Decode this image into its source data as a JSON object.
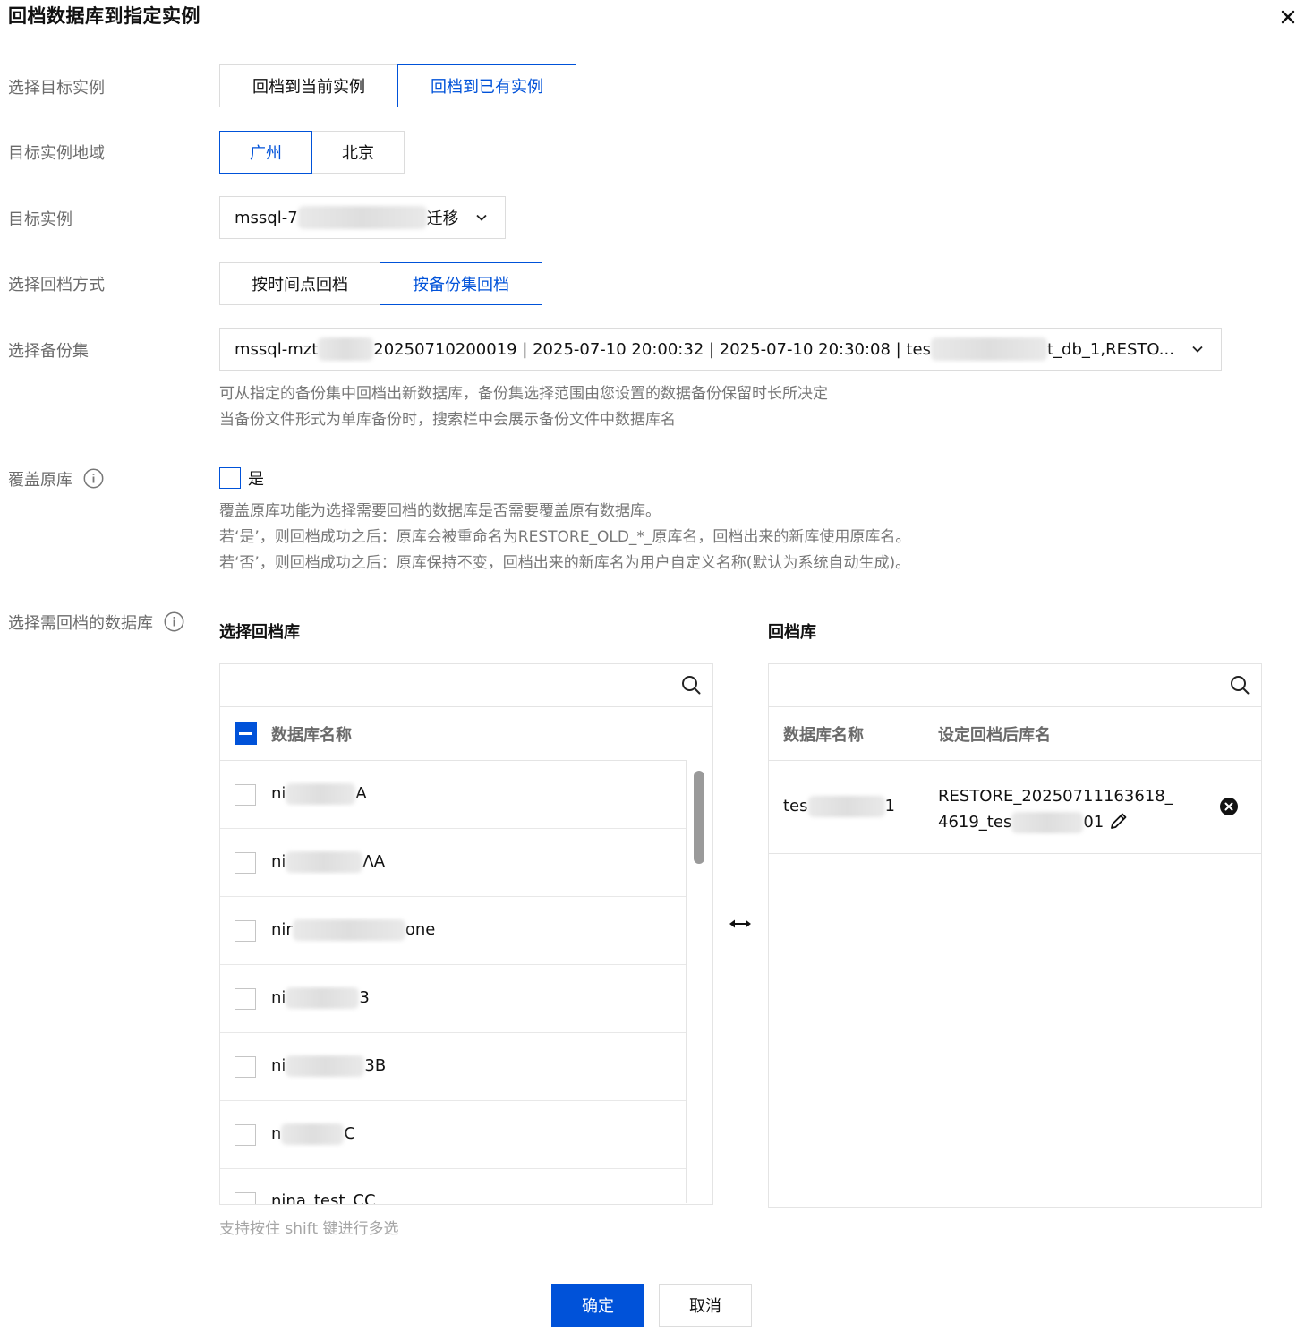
{
  "dialog": {
    "title": "回档数据库到指定实例"
  },
  "target_instance_type": {
    "label": "选择目标实例",
    "options": [
      "回档到当前实例",
      "回档到已有实例"
    ],
    "selected": "回档到已有实例"
  },
  "region": {
    "label": "目标实例地域",
    "options": [
      "广州",
      "北京"
    ],
    "selected": "广州"
  },
  "target_instance": {
    "label": "目标实例",
    "value_prefix": "mssql-7",
    "value_suffix": "迁移"
  },
  "rollback_mode": {
    "label": "选择回档方式",
    "options": [
      "按时间点回档",
      "按备份集回档"
    ],
    "selected": "按备份集回档"
  },
  "backup_set": {
    "label": "选择备份集",
    "value_prefix": "mssql-mzt",
    "value_middle": "20250710200019 | 2025-07-10 20:00:32 | 2025-07-10 20:30:08 | tes",
    "value_suffix": "t_db_1,RESTO...",
    "hint_lines": [
      "可从指定的备份集中回档出新数据库，备份集选择范围由您设置的数据备份保留时长所决定",
      "当备份文件形式为单库备份时，搜索栏中会展示备份文件中数据库名"
    ]
  },
  "overwrite": {
    "label": "覆盖原库",
    "checkbox_label": "是",
    "checked": false,
    "hint_lines": [
      "覆盖原库功能为选择需要回档的数据库是否需要覆盖原有数据库。",
      "若‘是’，则回档成功之后：原库会被重命名为RESTORE_OLD_*_原库名，回档出来的新库使用原库名。",
      "若‘否’，则回档成功之后：原库保持不变，回档出来的新库名为用户自定义名称(默认为系统自动生成)。"
    ]
  },
  "databases": {
    "label": "选择需回档的数据库",
    "source_panel": {
      "title": "选择回档库",
      "search_placeholder": "",
      "column_name": "数据库名称",
      "rows": [
        {
          "prefix": "ni",
          "suffix": "A"
        },
        {
          "prefix": "ni",
          "suffix": "ΛA"
        },
        {
          "prefix": "nir",
          "suffix": "one"
        },
        {
          "prefix": "ni",
          "suffix": "3"
        },
        {
          "prefix": "ni",
          "suffix": "3B"
        },
        {
          "prefix": "n",
          "suffix": "C"
        },
        {
          "prefix": "nina_test_CC",
          "suffix": ""
        }
      ]
    },
    "target_panel": {
      "title": "回档库",
      "search_placeholder": "",
      "column_name": "数据库名称",
      "column_new_name": "设定回档后库名",
      "rows": [
        {
          "name_prefix": "tes",
          "name_suffix": "1",
          "new_name_line1": "RESTORE_20250711163618_",
          "new_name_line2_prefix": "4619_tes",
          "new_name_line2_suffix": "01"
        }
      ]
    },
    "multi_select_hint": "支持按住 shift 键进行多选"
  },
  "footer": {
    "confirm": "确定",
    "cancel": "取消"
  },
  "colors": {
    "primary": "#0052d9",
    "label": "#6b6b6b",
    "hint": "#777777",
    "border": "#dcdcdc"
  }
}
